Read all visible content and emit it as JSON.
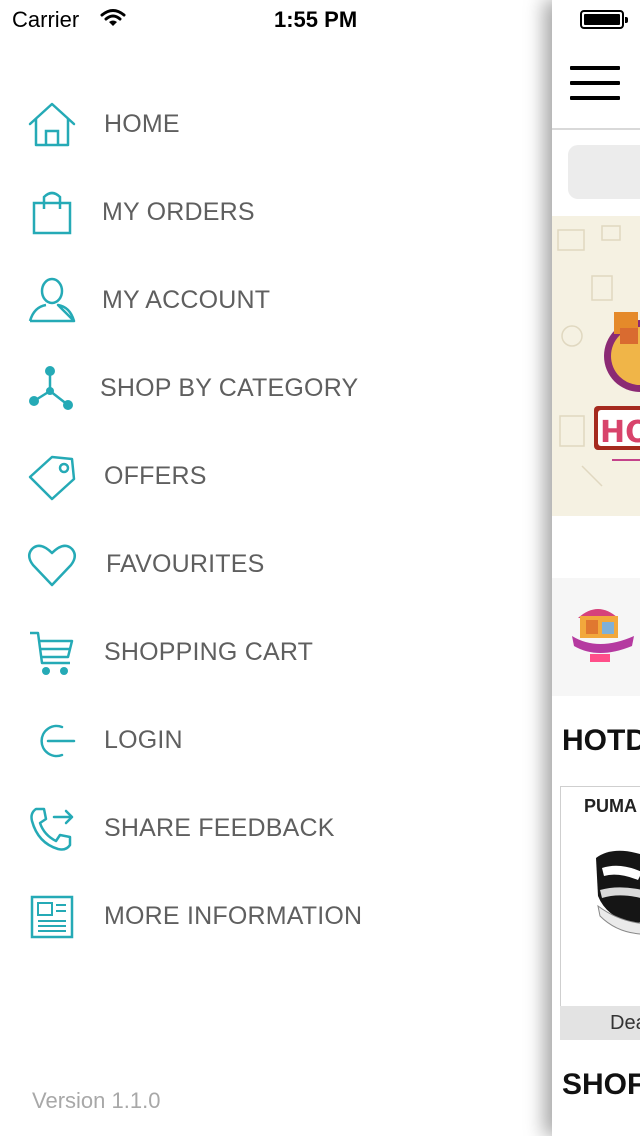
{
  "status_bar": {
    "carrier": "Carrier",
    "time": "1:55 PM"
  },
  "accent_color": "#25aab6",
  "menu": {
    "items": [
      {
        "label": "HOME",
        "icon": "home-icon"
      },
      {
        "label": "MY ORDERS",
        "icon": "shopping-bag-icon"
      },
      {
        "label": "MY ACCOUNT",
        "icon": "user-icon"
      },
      {
        "label": "SHOP BY CATEGORY",
        "icon": "category-network-icon"
      },
      {
        "label": "OFFERS",
        "icon": "tag-icon"
      },
      {
        "label": "FAVOURITES",
        "icon": "heart-icon"
      },
      {
        "label": "SHOPPING CART",
        "icon": "cart-icon"
      },
      {
        "label": "LOGIN",
        "icon": "login-icon"
      },
      {
        "label": "SHARE FEEDBACK",
        "icon": "phone-share-icon"
      },
      {
        "label": "MORE INFORMATION",
        "icon": "newspaper-icon"
      }
    ],
    "version": "Version 1.1.0"
  },
  "main": {
    "section_1_title": "HOTD",
    "product_brand": "PUMA",
    "deal_label": "Dea",
    "section_2_title": "SHOF"
  }
}
